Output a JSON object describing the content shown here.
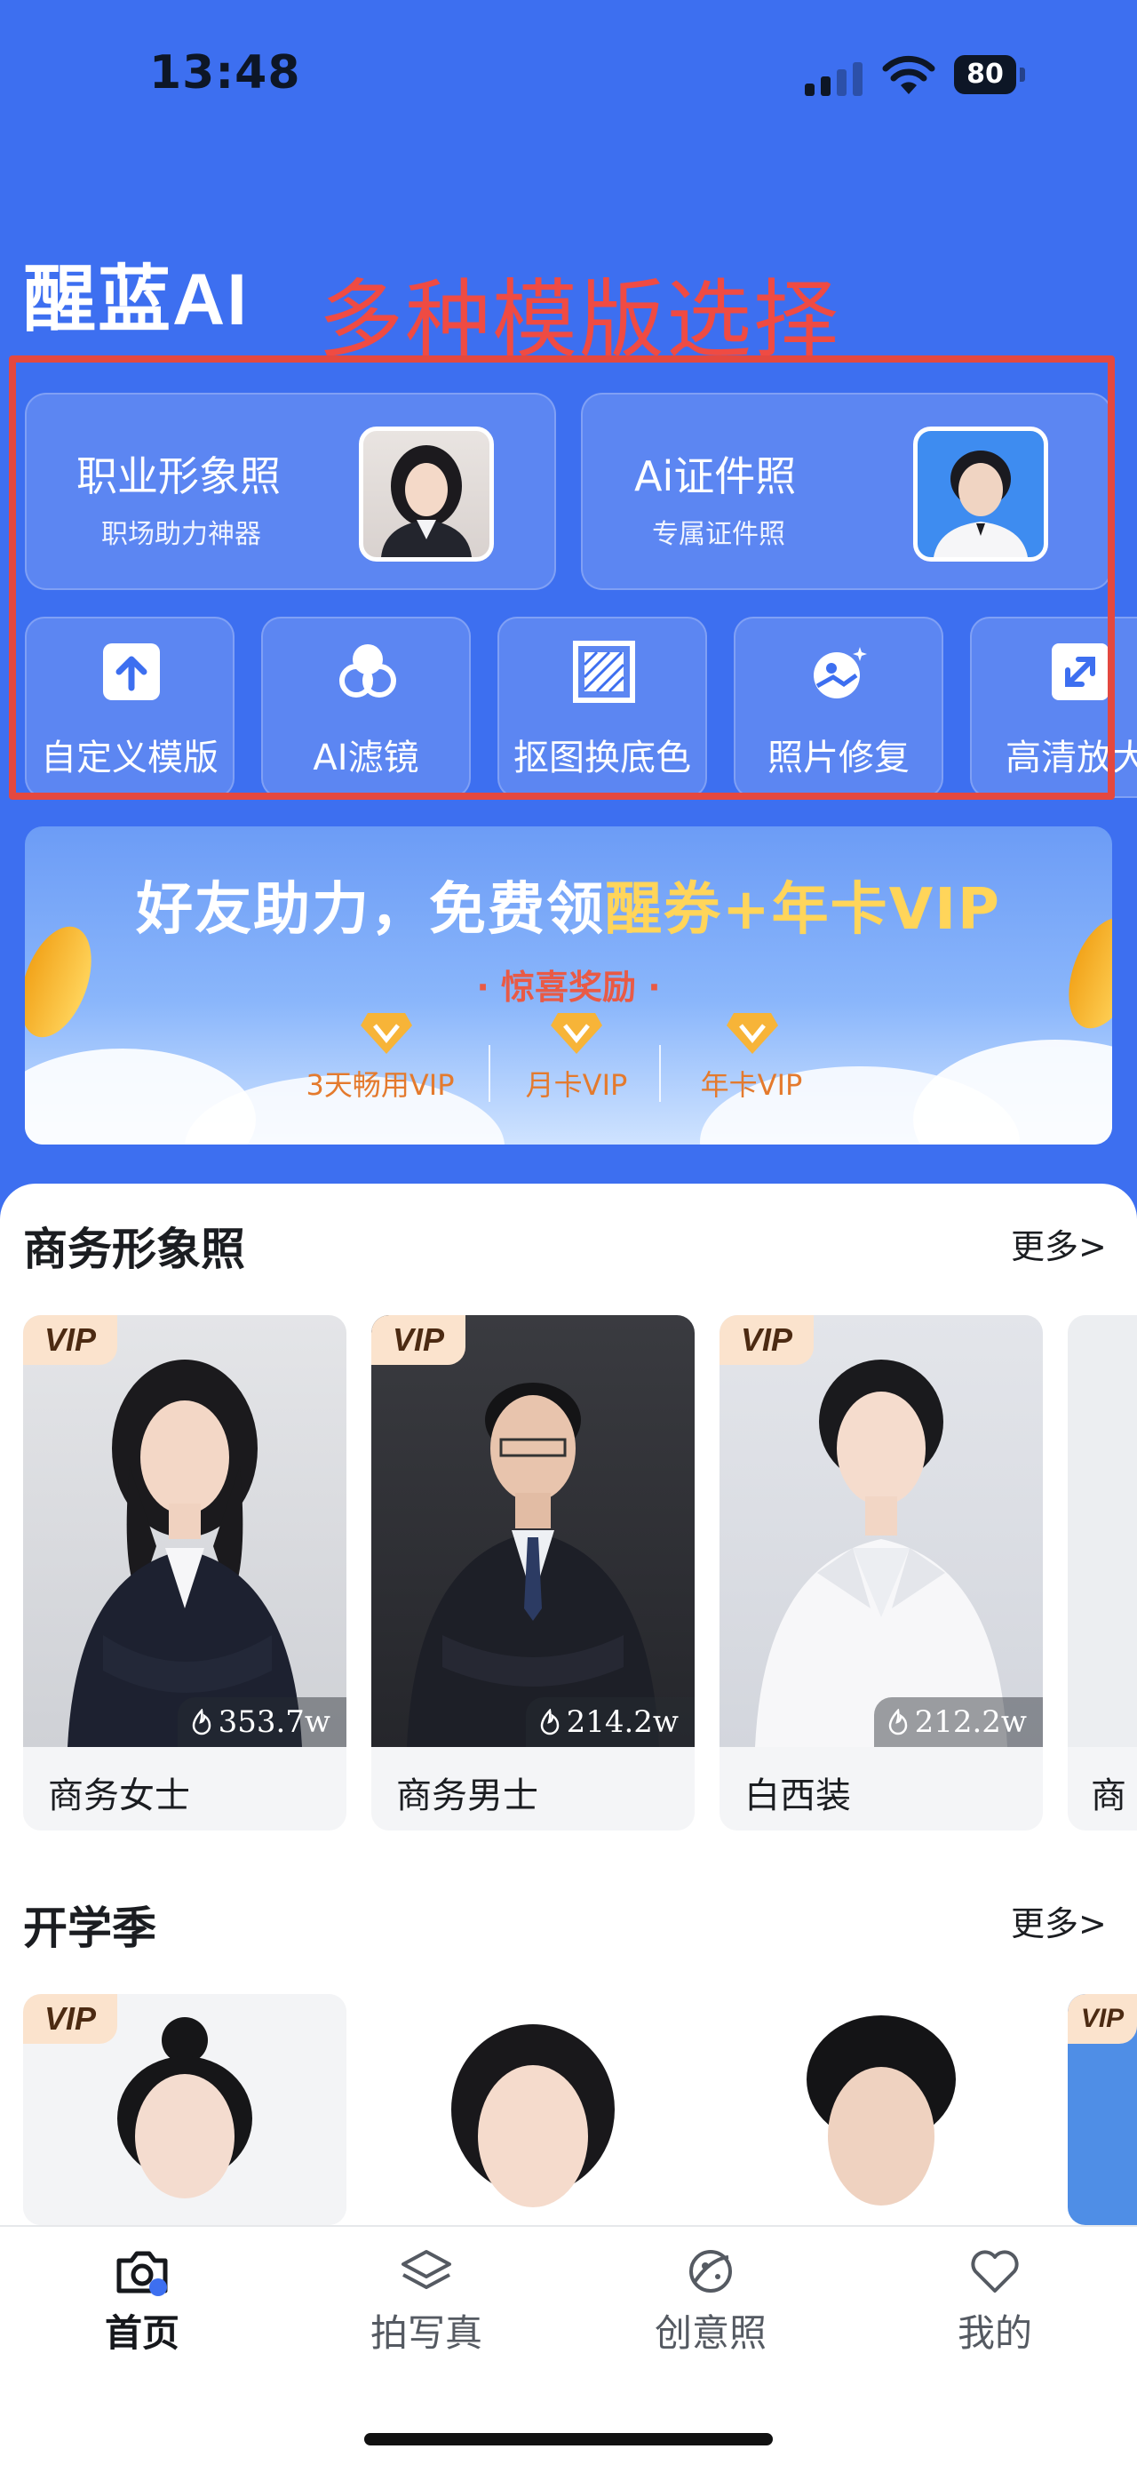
{
  "status_bar": {
    "time": "13:48",
    "battery": "80"
  },
  "app": {
    "logo": "醒蓝AI"
  },
  "annotation": {
    "text": "多种模版选择",
    "color": "#ef4b43"
  },
  "feature_cards": [
    {
      "title": "职业形象照",
      "subtitle": "职场助力神器"
    },
    {
      "title": "Ai证件照",
      "subtitle": "专属证件照"
    }
  ],
  "tools": [
    {
      "label": "自定义模版",
      "icon": "upload-icon"
    },
    {
      "label": "AI滤镜",
      "icon": "filter-icon"
    },
    {
      "label": "抠图换底色",
      "icon": "cutout-icon"
    },
    {
      "label": "照片修复",
      "icon": "photo-repair-icon"
    },
    {
      "label": "高清放大",
      "icon": "enlarge-icon"
    }
  ],
  "banner": {
    "headline_part1": "好友助力，免费领",
    "headline_part2": "醒券+年卡VIP",
    "sub": "· 惊喜奖励 ·",
    "tiers": [
      "3天畅用VIP",
      "月卡VIP",
      "年卡VIP"
    ]
  },
  "section_business": {
    "title": "商务形象照",
    "more": "更多>",
    "badge": "VIP",
    "cards": [
      {
        "name": "商务女士",
        "count": "353.7w"
      },
      {
        "name": "商务男士",
        "count": "214.2w"
      },
      {
        "name": "白西装",
        "count": "212.2w"
      },
      {
        "name": "商"
      }
    ]
  },
  "section_school": {
    "title": "开学季",
    "more": "更多>",
    "badge": "VIP"
  },
  "tabbar": [
    {
      "label": "首页",
      "icon": "camera-icon"
    },
    {
      "label": "拍写真",
      "icon": "layers-icon"
    },
    {
      "label": "创意照",
      "icon": "planet-icon"
    },
    {
      "label": "我的",
      "icon": "heart-icon"
    }
  ],
  "colors": {
    "brand_blue": "#3d6ff0",
    "vip_bg": "#fbe3cd",
    "gold": "#ffd55a"
  }
}
